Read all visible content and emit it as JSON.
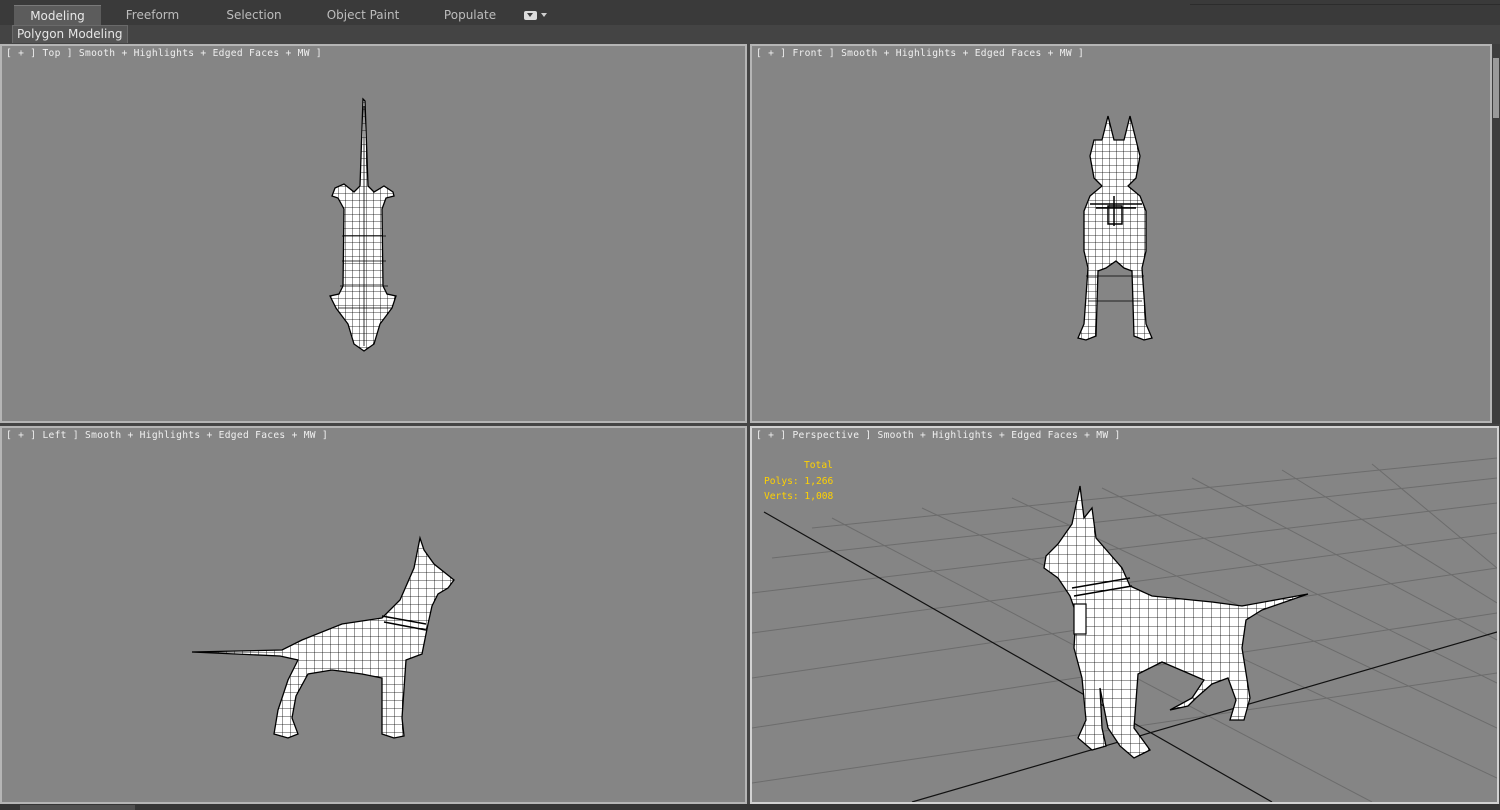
{
  "ribbon": {
    "tabs": [
      {
        "label": "Modeling",
        "active": true
      },
      {
        "label": "Freeform",
        "active": false
      },
      {
        "label": "Selection",
        "active": false
      },
      {
        "label": "Object Paint",
        "active": false
      },
      {
        "label": "Populate",
        "active": false
      }
    ],
    "menu_icon": "chevron-down-icon"
  },
  "subtab": {
    "label": "Polygon Modeling"
  },
  "viewports": {
    "top": {
      "label": "[ + ] Top ] Smooth + Highlights + Edged Faces + MW ]"
    },
    "front": {
      "label": "[ + ] Front ] Smooth + Highlights + Edged Faces + MW ]"
    },
    "left": {
      "label": "[ + ] Left ] Smooth + Highlights + Edged Faces + MW ]"
    },
    "perspective": {
      "label": "[ + ] Perspective ] Smooth + Highlights + Edged Faces + MW ]"
    }
  },
  "stats": {
    "total": "Total",
    "polys": "Polys: 1,266",
    "verts": "Verts: 1,008"
  },
  "colors": {
    "viewport_bg": "#858585",
    "ui_bg": "#444444",
    "stats_text": "#ffd200",
    "mesh_fill": "#ffffff",
    "mesh_wire": "#000000"
  }
}
